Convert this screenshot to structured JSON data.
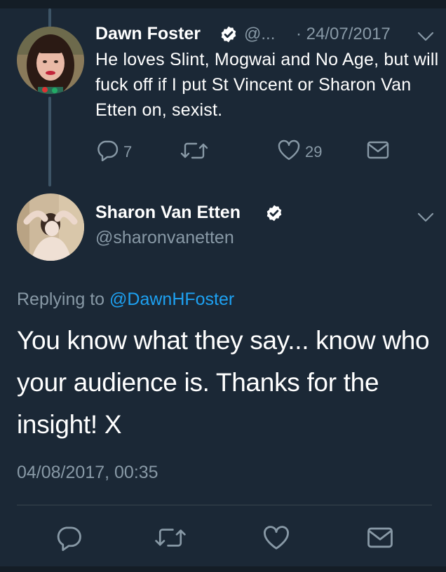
{
  "tweet1": {
    "author_name": "Dawn Foster",
    "handle_truncated": "@...",
    "date": "· 24/07/2017",
    "text": "He loves Slint, Mogwai and No Age, but will fuck off if I put St Vincent or Sharon Van Etten on, sexist.",
    "replies_count": "7",
    "retweets_count": "",
    "likes_count": "29"
  },
  "tweet2": {
    "author_name": "Sharon Van Etten",
    "handle": "@sharonvanetten",
    "replying_prefix": "Replying to",
    "replying_handle": "@DawnHFoster",
    "text": "You know what they say... know who your audience is.  Thanks for the insight!  X",
    "timestamp": "04/08/2017, 00:35"
  },
  "colors": {
    "background": "#1b2836",
    "muted": "#8899a6",
    "link": "#1da1f2",
    "thread_line": "#3d5466"
  },
  "icons": {
    "reply": "reply-icon",
    "retweet": "retweet-icon",
    "like": "heart-icon",
    "dm": "envelope-icon",
    "verified": "verified-badge-icon",
    "caret": "chevron-down-icon"
  }
}
